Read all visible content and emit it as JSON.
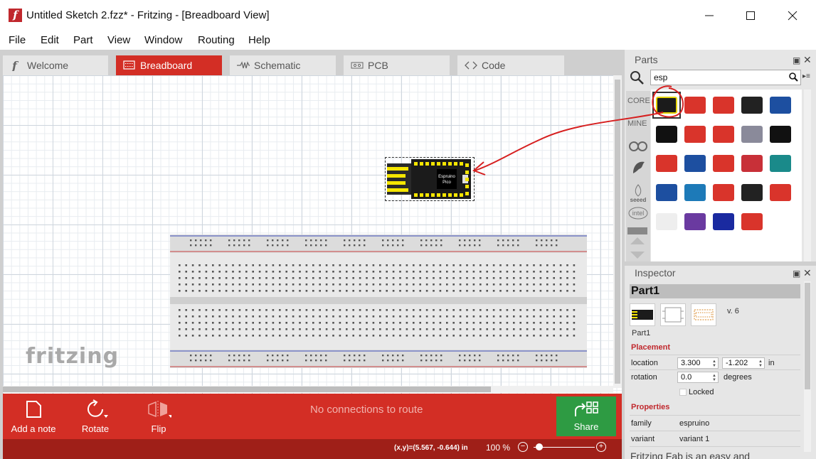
{
  "window": {
    "title": "Untitled Sketch 2.fzz* - Fritzing - [Breadboard View]",
    "logo_letter": "f"
  },
  "menu": [
    "File",
    "Edit",
    "Part",
    "View",
    "Window",
    "Routing",
    "Help"
  ],
  "tabs": [
    {
      "label": "Welcome",
      "icon": "fritzing-f-icon",
      "active": false
    },
    {
      "label": "Breadboard",
      "icon": "breadboard-icon",
      "active": true
    },
    {
      "label": "Schematic",
      "icon": "resistor-icon",
      "active": false
    },
    {
      "label": "PCB",
      "icon": "pcb-icon",
      "active": false
    },
    {
      "label": "Code",
      "icon": "code-brackets-icon",
      "active": false
    }
  ],
  "canvas": {
    "watermark": "fritzing",
    "part_label_line1": "Espruino",
    "part_label_line2": "Pico"
  },
  "toolbar": {
    "add_note": "Add a note",
    "rotate": "Rotate",
    "flip": "Flip",
    "route_status": "No connections to route",
    "share": "Share"
  },
  "statusbar": {
    "coords": "(x,y)=(5.567, -0.644) in",
    "zoom": "100 %",
    "zoom_level": 0.03
  },
  "parts": {
    "title": "Parts",
    "search_value": "esp",
    "bins": [
      "CORE",
      "MINE"
    ],
    "colors": {
      "accent": "#d32e25",
      "share": "#2e9b43",
      "status": "#9f1f18",
      "annotation": "#d61f1f"
    }
  },
  "inspector": {
    "title": "Inspector",
    "part_title": "Part1",
    "version": "v. 6",
    "part_caption": "Part1",
    "placement_heading": "Placement",
    "location_label": "location",
    "location_x": "3.300",
    "location_y": "-1.202",
    "location_unit": "in",
    "rotation_label": "rotation",
    "rotation_value": "0.0",
    "rotation_unit": "degrees",
    "locked_label": "Locked",
    "properties_heading": "Properties",
    "family_label": "family",
    "family_value": "espruino",
    "variant_label": "variant",
    "variant_value": "variant 1"
  },
  "background_peek": "Fritzing Fab is an easy and"
}
